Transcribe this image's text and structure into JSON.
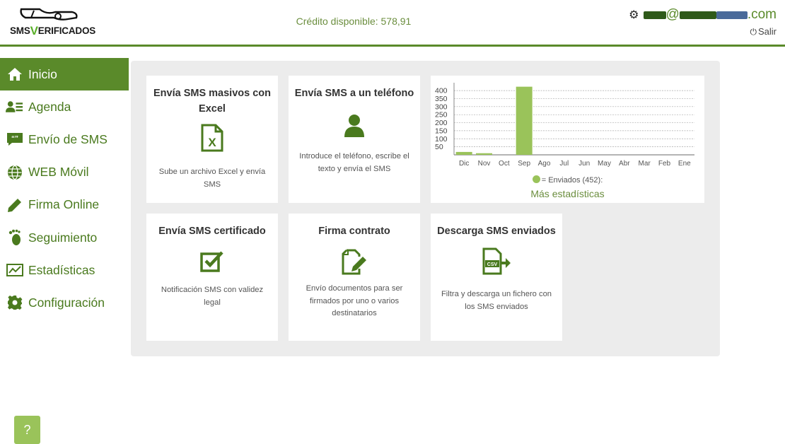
{
  "header": {
    "logo_prefix": "SMS",
    "logo_v": "V",
    "logo_suffix": "ERIFICADOS",
    "credit_text": "Crédito disponible: 578,91",
    "user_at": "@",
    "user_domain_end": ".com",
    "logout_label": "Salir"
  },
  "sidebar": {
    "items": [
      {
        "label": "Inicio",
        "icon": "home-icon"
      },
      {
        "label": "Agenda",
        "icon": "contacts-icon"
      },
      {
        "label": "Envío de SMS",
        "icon": "sms-icon"
      },
      {
        "label": "WEB Móvil",
        "icon": "globe-icon"
      },
      {
        "label": "Firma Online",
        "icon": "pen-icon"
      },
      {
        "label": "Seguimiento",
        "icon": "footprint-icon"
      },
      {
        "label": "Estadísticas",
        "icon": "chart-icon"
      },
      {
        "label": "Configuración",
        "icon": "gear-icon"
      }
    ]
  },
  "cards": [
    {
      "title": "Envía SMS masivos con Excel",
      "desc": "Sube un archivo Excel y envía SMS",
      "icon": "excel-file-icon"
    },
    {
      "title": "Envía SMS a un teléfono",
      "desc": "Introduce el teléfono, escribe el texto y envía el SMS",
      "icon": "user-icon"
    },
    {
      "title": "Envía SMS certificado",
      "desc": "Notificación SMS con validez legal",
      "icon": "check-square-icon"
    },
    {
      "title": "Firma contrato",
      "desc": "Envío documentos para ser firmados por uno o varios destinatarios",
      "icon": "sign-document-icon"
    },
    {
      "title": "Descarga SMS enviados",
      "desc": "Filtra y descarga un fichero con los SMS enviados",
      "icon": "csv-export-icon"
    }
  ],
  "chart_data": {
    "type": "bar",
    "categories": [
      "Dic",
      "Nov",
      "Oct",
      "Sep",
      "Ago",
      "Jul",
      "Jun",
      "May",
      "Abr",
      "Mar",
      "Feb",
      "Ene"
    ],
    "series": [
      {
        "name": "Enviados",
        "values": [
          18,
          10,
          0,
          424,
          0,
          0,
          0,
          0,
          0,
          0,
          0,
          0
        ]
      }
    ],
    "yticks": [
      50,
      100,
      150,
      200,
      250,
      300,
      350,
      400
    ],
    "ylim": [
      0,
      440
    ],
    "legend_text": "= Enviados (452):",
    "color": "#9ac35a",
    "grid": true
  },
  "more_stats": "Más estadísticas",
  "help_label": "?"
}
